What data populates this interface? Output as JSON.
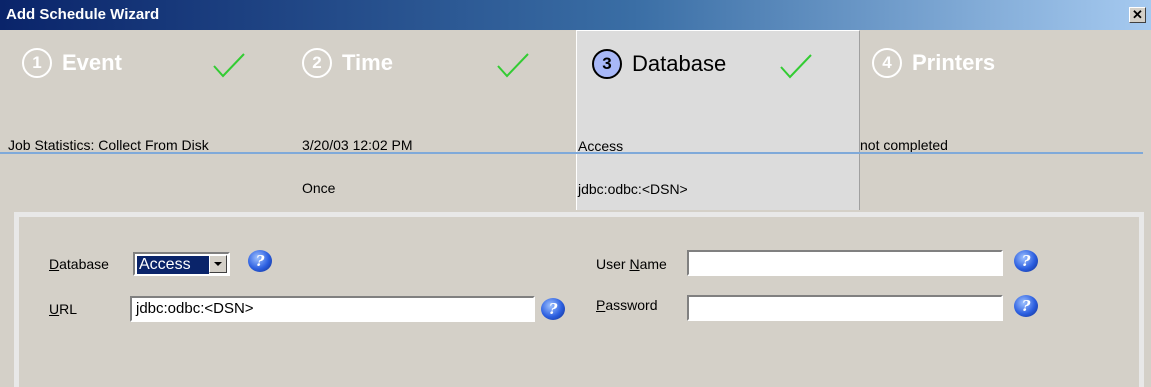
{
  "window": {
    "title": "Add Schedule Wizard",
    "close_label": "✕"
  },
  "steps": [
    {
      "number": "1",
      "label": "Event",
      "done": true,
      "info": [
        "Job Statistics: Collect From Disk",
        ""
      ]
    },
    {
      "number": "2",
      "label": "Time",
      "done": true,
      "info": [
        "3/20/03 12:02 PM",
        "Once"
      ]
    },
    {
      "number": "3",
      "label": "Database",
      "done": true,
      "active": true,
      "info": [
        "Access",
        "jdbc:odbc:<DSN>"
      ]
    },
    {
      "number": "4",
      "label": "Printers",
      "done": false,
      "info": [
        "not completed",
        ""
      ]
    }
  ],
  "form": {
    "database_label_prefix": "",
    "database_label_u": "D",
    "database_label_rest": "atabase",
    "database_value": "Access",
    "url_label_u": "U",
    "url_label_rest": "RL",
    "url_value": "jdbc:odbc:<DSN>",
    "user_label_pre": "User ",
    "user_label_u": "N",
    "user_label_rest": "ame",
    "user_value": "",
    "password_label_u": "P",
    "password_label_rest": "assword",
    "password_value": "",
    "help_glyph": "?"
  },
  "colors": {
    "check": "#33cc33",
    "accent_line": "#7fa9d9",
    "title_bar": "#0a246a"
  }
}
